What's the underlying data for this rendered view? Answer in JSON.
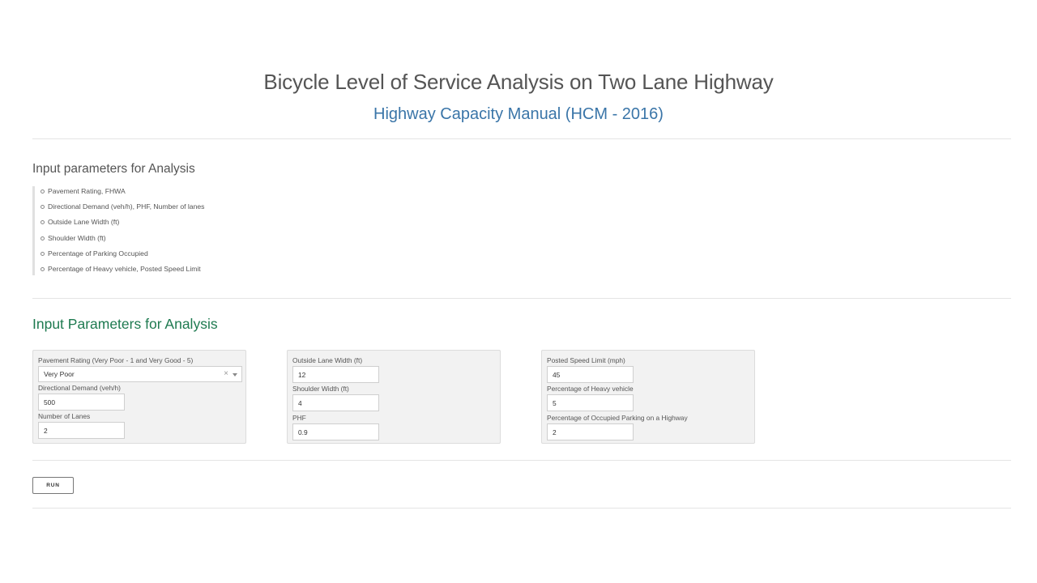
{
  "header": {
    "title": "Bicycle Level of Service Analysis on Two Lane Highway",
    "subtitle": "Highway Capacity Manual (HCM - 2016)"
  },
  "info": {
    "heading": "Input parameters for Analysis",
    "items": [
      "Pavement Rating, FHWA",
      "Directional Demand (veh/h), PHF, Number of lanes",
      "Outside Lane Width (ft)",
      "Shoulder Width (ft)",
      "Percentage of Parking Occupied",
      "Percentage of Heavy vehicle, Posted Speed Limit"
    ]
  },
  "form": {
    "heading": "Input Parameters for Analysis",
    "panel1": {
      "pavement_label": "Pavement Rating (Very Poor - 1 and Very Good - 5)",
      "pavement_value": "Very Poor",
      "pavement_clear": "×",
      "demand_label": "Directional Demand (veh/h)",
      "demand_value": "500",
      "lanes_label": "Number of Lanes",
      "lanes_value": "2"
    },
    "panel2": {
      "lane_width_label": "Outside Lane Width (ft)",
      "lane_width_value": "12",
      "shoulder_label": "Shoulder Width (ft)",
      "shoulder_value": "4",
      "phf_label": "PHF",
      "phf_value": "0.9"
    },
    "panel3": {
      "speed_label": "Posted Speed Limit (mph)",
      "speed_value": "45",
      "heavy_label": "Percentage of Heavy vehicle",
      "heavy_value": "5",
      "parking_label": "Percentage of Occupied Parking on a Highway",
      "parking_value": "2"
    },
    "run_label": "RUN"
  }
}
